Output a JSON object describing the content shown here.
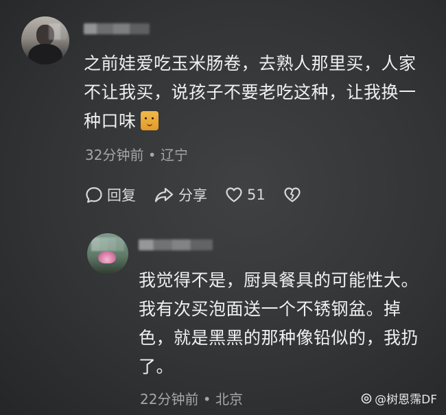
{
  "comments": [
    {
      "username": "",
      "lines": [
        "之前娃爱吃玉米肠卷，去熟人那里买，人家",
        "不让我买，说孩子不要老吃这种，让我换一",
        "种口味"
      ],
      "emoji": "cat-face-emoji",
      "time_location": "32分钟前 • 辽宁",
      "actions": {
        "reply": "回复",
        "share": "分享",
        "likes": "51"
      }
    },
    {
      "username": "",
      "lines": [
        "我觉得不是，厨具餐具的可能性大。",
        "我有次买泡面送一个不锈钢盆。掉",
        "色，就是黑黑的那种像铅似的，我扔",
        "了。"
      ],
      "time_location": "22分钟前 • 北京"
    }
  ],
  "watermark": "@树恩霈DF",
  "icons": [
    "reply-icon",
    "share-icon",
    "heart-icon",
    "broken-heart-icon",
    "at-icon"
  ]
}
